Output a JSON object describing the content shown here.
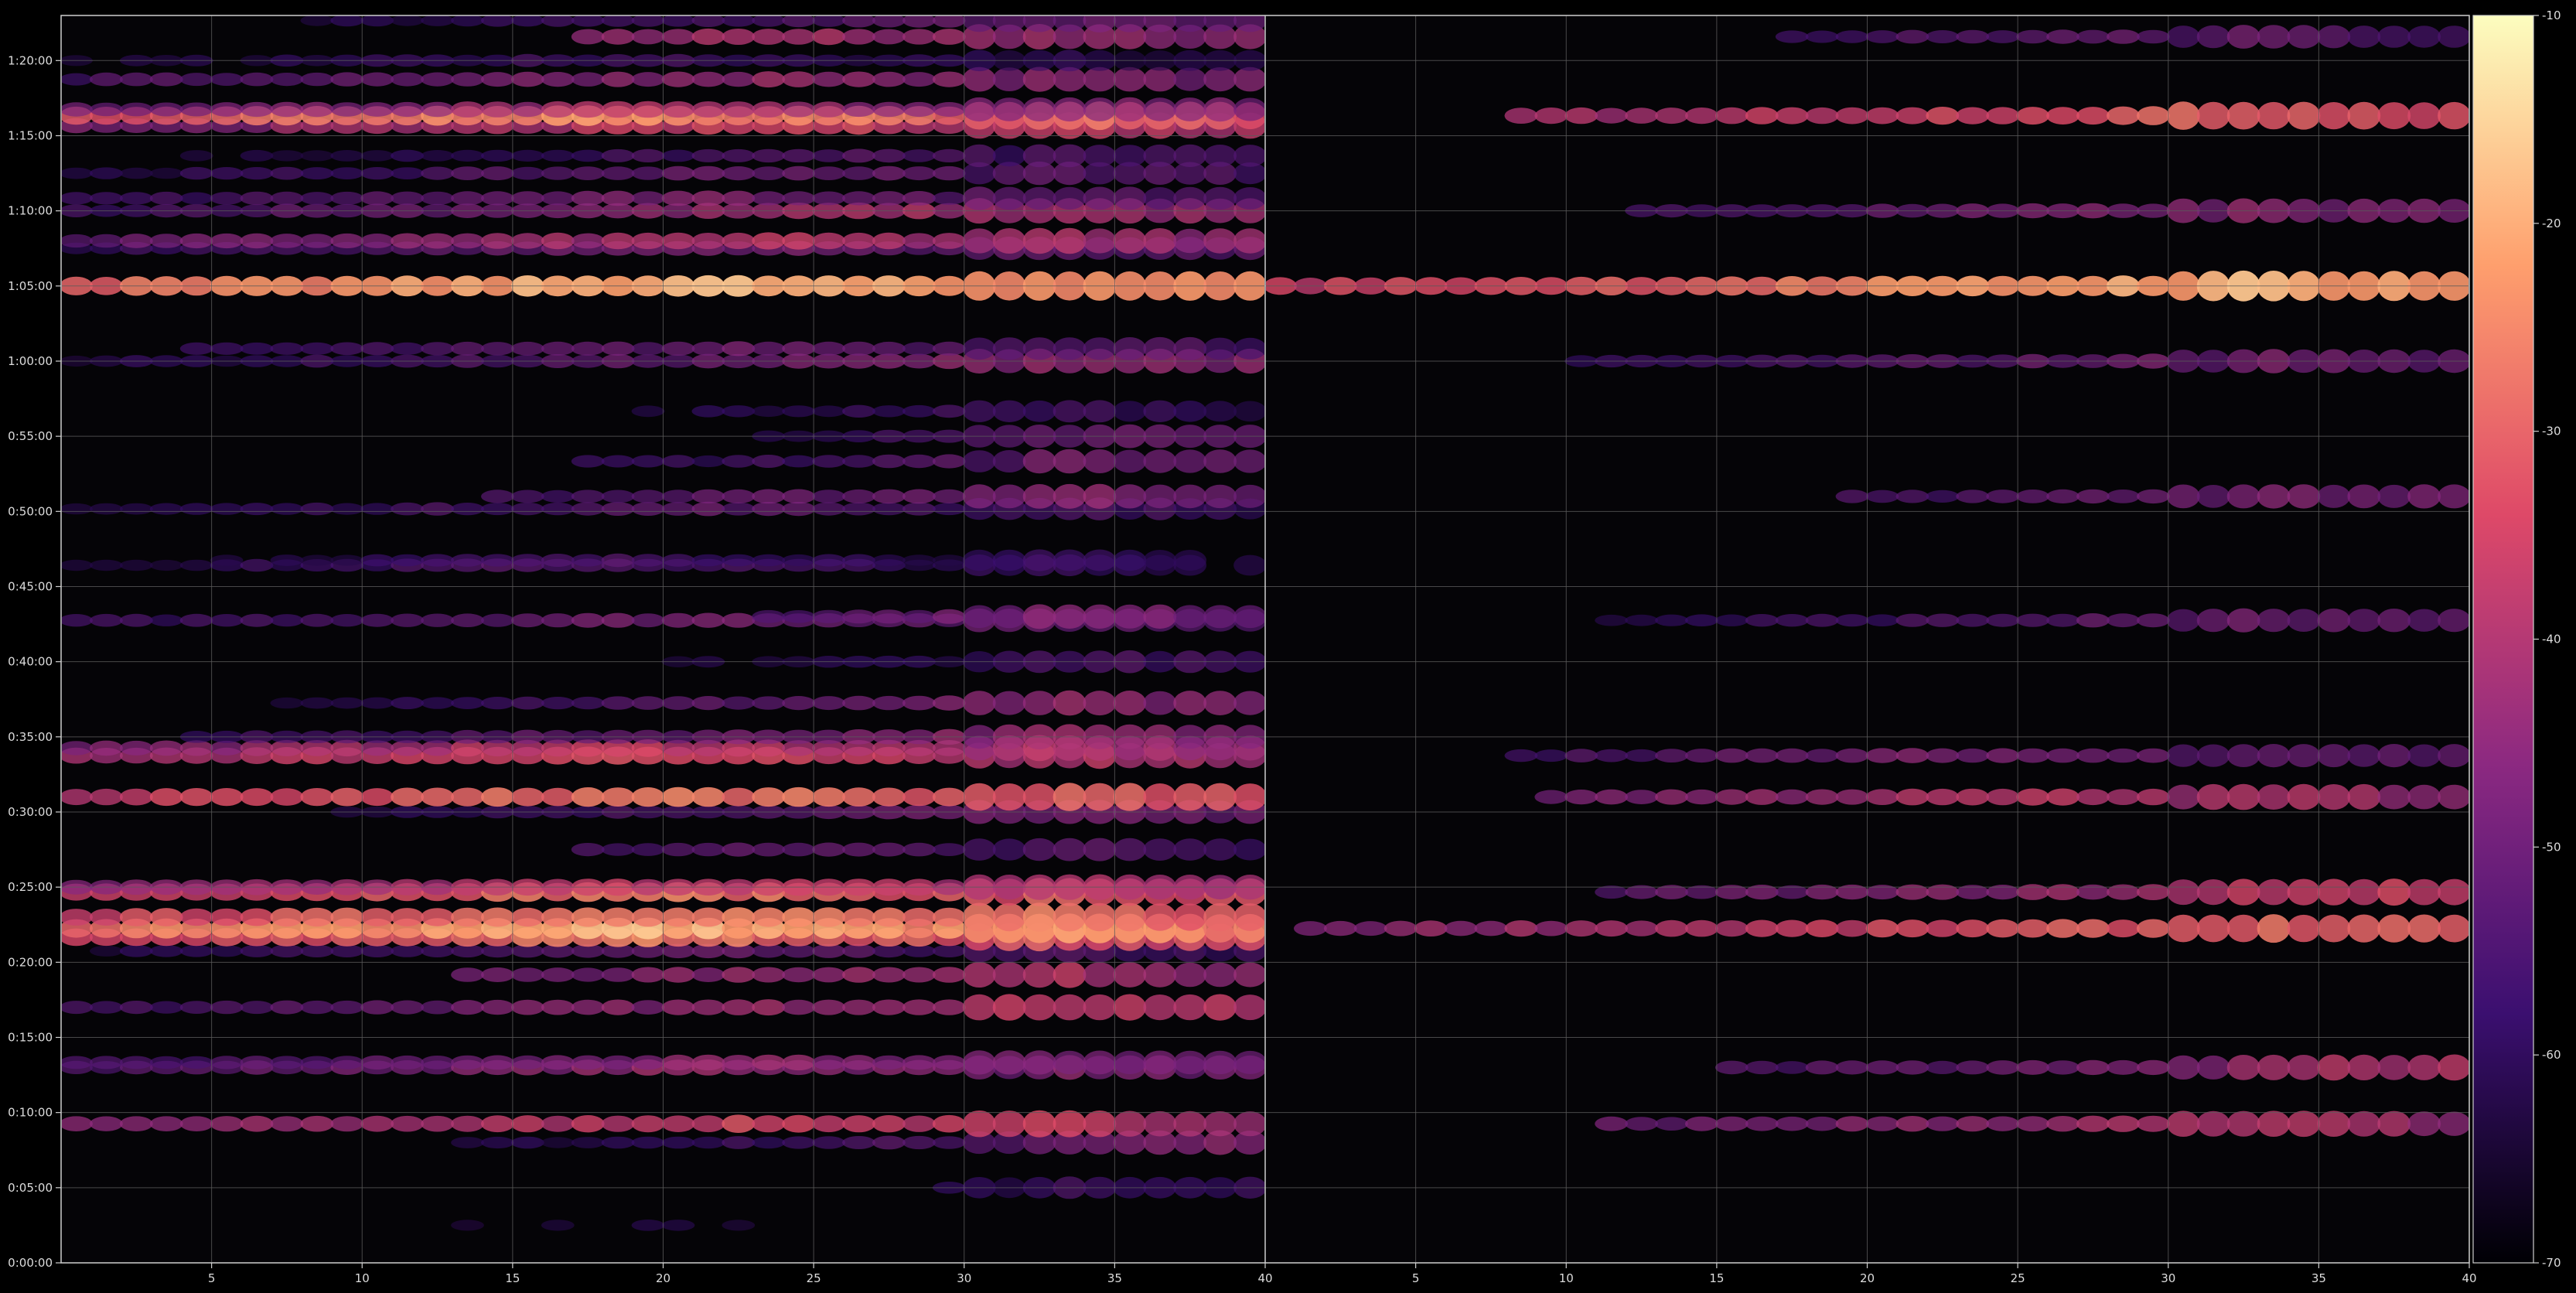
{
  "chart_data": {
    "type": "heatmap",
    "title": "",
    "xlabel": "",
    "ylabel": "",
    "grid": true,
    "colormap": [
      "#000004",
      "#3b0f70",
      "#8c2981",
      "#de4968",
      "#fe9f6d",
      "#fcfdbf"
    ],
    "background": "#000000",
    "gridColor": "#5a5a5a",
    "panels": [
      {
        "name": "",
        "xlim": [
          1,
          40
        ],
        "xticks": [
          5,
          10,
          15,
          20,
          25,
          30,
          35,
          40
        ],
        "xtickLabels": [
          "5",
          "10",
          "15",
          "20",
          "25",
          "30",
          "35",
          "40"
        ],
        "rowStart": 1,
        "channelScale": 1.0
      },
      {
        "name": "",
        "xlim": [
          1,
          40
        ],
        "xticks": [
          5,
          10,
          15,
          20,
          25,
          30,
          35,
          40
        ],
        "xtickLabels": [
          "5",
          "10",
          "15",
          "20",
          "25",
          "30",
          "35",
          "40"
        ],
        "rowStart": 1,
        "channelScale": 1.0
      }
    ],
    "yTicks": [
      0,
      300,
      600,
      900,
      1200,
      1500,
      1800,
      2100,
      2400,
      2700,
      3000,
      3300,
      3600,
      3900,
      4200,
      4500,
      4800
    ],
    "yTickLabels": [
      "0:00:00",
      "0:05:00",
      "0:10:00",
      "0:15:00",
      "0:20:00",
      "0:25:00",
      "0:30:00",
      "0:35:00",
      "0:40:00",
      "0:45:00",
      "0:50:00",
      "0:55:00",
      "1:00:00",
      "1:05:00",
      "1:10:00",
      "1:15:00",
      "1:20:00"
    ],
    "ylim": [
      0,
      4980
    ],
    "colorbar": {
      "range": [
        -70,
        -10
      ],
      "ticks": [
        -10,
        -20,
        -30,
        -40,
        -50,
        -60,
        -70
      ],
      "tickLabels": [
        "-10",
        "-20",
        "-30",
        "-40",
        "-50",
        "-60",
        "-70"
      ]
    },
    "bands": [
      {
        "time": 150,
        "level": -62,
        "startCol": 13,
        "endCol": 40,
        "peakCol": 20
      },
      {
        "time": 300,
        "level": -58,
        "startCol": 30,
        "endCol": 40,
        "peakCol": 35
      },
      {
        "time": 480,
        "level": -48,
        "startCol": 14,
        "endCol": 40,
        "peakCol": 38
      },
      {
        "time": 555,
        "level": -34,
        "startCol": 1,
        "endCol": 40,
        "peakCol": 24
      },
      {
        "time": 780,
        "level": -42,
        "startCol": 1,
        "endCol": 40,
        "peakCol": 22
      },
      {
        "time": 800,
        "level": -44,
        "startCol": 1,
        "endCol": 40,
        "peakCol": 24
      },
      {
        "time": 1020,
        "level": -38,
        "startCol": 1,
        "endCol": 40,
        "peakCol": 32
      },
      {
        "time": 1150,
        "level": -40,
        "startCol": 14,
        "endCol": 40,
        "peakCol": 30
      },
      {
        "time": 1245,
        "level": -50,
        "startCol": 1,
        "endCol": 40,
        "peakCol": 22
      },
      {
        "time": 1300,
        "level": -26,
        "startCol": 1,
        "endCol": 40,
        "peakCol": 20
      },
      {
        "time": 1335,
        "level": -18,
        "startCol": 1,
        "endCol": 40,
        "peakCol": 19
      },
      {
        "time": 1380,
        "level": -24,
        "startCol": 1,
        "endCol": 40,
        "peakCol": 21
      },
      {
        "time": 1480,
        "level": -26,
        "startCol": 1,
        "endCol": 40,
        "peakCol": 20
      },
      {
        "time": 1500,
        "level": -36,
        "startCol": 1,
        "endCol": 40,
        "peakCol": 22
      },
      {
        "time": 1650,
        "level": -50,
        "startCol": 18,
        "endCol": 40,
        "peakCol": 26
      },
      {
        "time": 1800,
        "level": -48,
        "startCol": 10,
        "endCol": 40,
        "peakCol": 30
      },
      {
        "time": 1860,
        "level": -26,
        "startCol": 1,
        "endCol": 40,
        "peakCol": 21
      },
      {
        "time": 2025,
        "level": -32,
        "startCol": 1,
        "endCol": 40,
        "peakCol": 18
      },
      {
        "time": 2055,
        "level": -36,
        "startCol": 1,
        "endCol": 40,
        "peakCol": 20
      },
      {
        "time": 2100,
        "level": -44,
        "startCol": 5,
        "endCol": 40,
        "peakCol": 30
      },
      {
        "time": 2235,
        "level": -46,
        "startCol": 8,
        "endCol": 40,
        "peakCol": 32
      },
      {
        "time": 2400,
        "level": -56,
        "startCol": 20,
        "endCol": 40,
        "peakCol": 34
      },
      {
        "time": 2565,
        "level": -46,
        "startCol": 1,
        "endCol": 40,
        "peakCol": 22
      },
      {
        "time": 2580,
        "level": -48,
        "startCol": 24,
        "endCol": 40,
        "peakCol": 32
      },
      {
        "time": 2785,
        "level": -52,
        "startCol": 1,
        "endCol": 40,
        "peakCol": 18
      },
      {
        "time": 2805,
        "level": -54,
        "startCol": 1,
        "endCol": 40,
        "peakCol": 20
      },
      {
        "time": 3010,
        "level": -50,
        "startCol": 1,
        "endCol": 40,
        "peakCol": 22
      },
      {
        "time": 3060,
        "level": -46,
        "startCol": 15,
        "endCol": 40,
        "peakCol": 32
      },
      {
        "time": 3200,
        "level": -50,
        "startCol": 18,
        "endCol": 40,
        "peakCol": 34
      },
      {
        "time": 3300,
        "level": -52,
        "startCol": 24,
        "endCol": 40,
        "peakCol": 36
      },
      {
        "time": 3400,
        "level": -56,
        "startCol": 20,
        "endCol": 40,
        "peakCol": 30
      },
      {
        "time": 3600,
        "level": -44,
        "startCol": 1,
        "endCol": 40,
        "peakCol": 32
      },
      {
        "time": 3650,
        "level": -48,
        "startCol": 5,
        "endCol": 40,
        "peakCol": 24
      },
      {
        "time": 3900,
        "level": -18,
        "startCol": 1,
        "endCol": 40,
        "peakCol": 21
      },
      {
        "time": 4050,
        "level": -46,
        "startCol": 1,
        "endCol": 40,
        "peakCol": 22
      },
      {
        "time": 4080,
        "level": -38,
        "startCol": 1,
        "endCol": 40,
        "peakCol": 24
      },
      {
        "time": 4200,
        "level": -40,
        "startCol": 1,
        "endCol": 40,
        "peakCol": 28
      },
      {
        "time": 4250,
        "level": -46,
        "startCol": 1,
        "endCol": 40,
        "peakCol": 22
      },
      {
        "time": 4350,
        "level": -48,
        "startCol": 1,
        "endCol": 40,
        "peakCol": 24
      },
      {
        "time": 4420,
        "level": -52,
        "startCol": 1,
        "endCol": 40,
        "peakCol": 26
      },
      {
        "time": 4540,
        "level": -34,
        "startCol": 1,
        "endCol": 40,
        "peakCol": 25
      },
      {
        "time": 4580,
        "level": -22,
        "startCol": 1,
        "endCol": 40,
        "peakCol": 18
      },
      {
        "time": 4605,
        "level": -40,
        "startCol": 1,
        "endCol": 40,
        "peakCol": 20
      },
      {
        "time": 4725,
        "level": -42,
        "startCol": 1,
        "endCol": 40,
        "peakCol": 24
      },
      {
        "time": 4800,
        "level": -54,
        "startCol": 1,
        "endCol": 40,
        "peakCol": 20
      },
      {
        "time": 4895,
        "level": -40,
        "startCol": 18,
        "endCol": 40,
        "peakCol": 24
      },
      {
        "time": 4960,
        "level": -50,
        "startCol": 8,
        "endCol": 40,
        "peakCol": 30
      }
    ],
    "secondPanelBands": [
      {
        "time": 555,
        "level": -40,
        "startCol": 12,
        "endCol": 40,
        "peakCol": 30
      },
      {
        "time": 780,
        "level": -42,
        "startCol": 16,
        "endCol": 40,
        "peakCol": 38
      },
      {
        "time": 1335,
        "level": -30,
        "startCol": 2,
        "endCol": 40,
        "peakCol": 30
      },
      {
        "time": 1480,
        "level": -38,
        "startCol": 12,
        "endCol": 40,
        "peakCol": 36
      },
      {
        "time": 1860,
        "level": -38,
        "startCol": 10,
        "endCol": 40,
        "peakCol": 26
      },
      {
        "time": 2025,
        "level": -46,
        "startCol": 9,
        "endCol": 40,
        "peakCol": 24
      },
      {
        "time": 2565,
        "level": -50,
        "startCol": 12,
        "endCol": 40,
        "peakCol": 30
      },
      {
        "time": 3060,
        "level": -48,
        "startCol": 20,
        "endCol": 40,
        "peakCol": 32
      },
      {
        "time": 3600,
        "level": -48,
        "startCol": 11,
        "endCol": 40,
        "peakCol": 30
      },
      {
        "time": 3900,
        "level": -20,
        "startCol": 1,
        "endCol": 40,
        "peakCol": 30
      },
      {
        "time": 4200,
        "level": -46,
        "startCol": 13,
        "endCol": 40,
        "peakCol": 30
      },
      {
        "time": 4580,
        "level": -30,
        "startCol": 9,
        "endCol": 40,
        "peakCol": 30
      },
      {
        "time": 4895,
        "level": -50,
        "startCol": 18,
        "endCol": 40,
        "peakCol": 28
      }
    ]
  }
}
